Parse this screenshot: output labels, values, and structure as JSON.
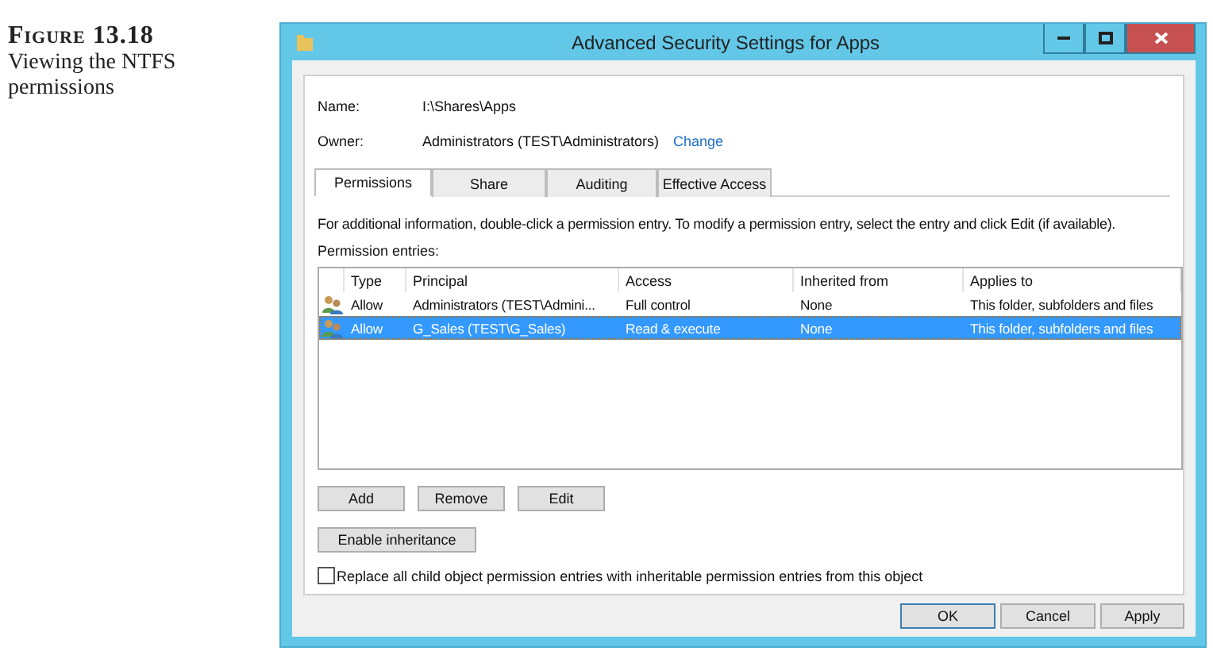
{
  "caption": {
    "label": "Figure 13.18",
    "text": "Viewing the NTFS permissions"
  },
  "window": {
    "title": "Advanced Security Settings for Apps"
  },
  "fields": [
    {
      "label": "Name:",
      "value": "I:\\Shares\\Apps"
    },
    {
      "label": "Owner:",
      "value": "Administrators (TEST\\Administrators)",
      "link": "Change"
    }
  ],
  "tabs": [
    {
      "label": "Permissions",
      "selected": true
    },
    {
      "label": "Share",
      "selected": false
    },
    {
      "label": "Auditing",
      "selected": false
    },
    {
      "label": "Effective Access",
      "selected": false
    }
  ],
  "info": "For additional information, double-click a permission entry. To modify a permission entry, select the entry and click Edit (if available).",
  "table": {
    "label": "Permission entries:",
    "columns": [
      "Type",
      "Principal",
      "Access",
      "Inherited from",
      "Applies to"
    ],
    "rows": [
      {
        "cells": [
          "Allow",
          "Administrators (TEST\\Admini...",
          "Full control",
          "None",
          "This folder, subfolders and files"
        ],
        "selected": false
      },
      {
        "cells": [
          "Allow",
          "G_Sales (TEST\\G_Sales)",
          "Read & execute",
          "None",
          "This folder, subfolders and files"
        ],
        "selected": true
      }
    ]
  },
  "entry_buttons": [
    "Add",
    "Remove",
    "Edit"
  ],
  "inheritance_button": "Enable inheritance",
  "replace_checkbox": {
    "label": "Replace all child object permission entries with inheritable permission entries from this object",
    "checked": false
  },
  "buttons": [
    {
      "label": "OK",
      "default": true
    },
    {
      "label": "Cancel",
      "default": false
    },
    {
      "label": "Apply",
      "default": false
    }
  ]
}
